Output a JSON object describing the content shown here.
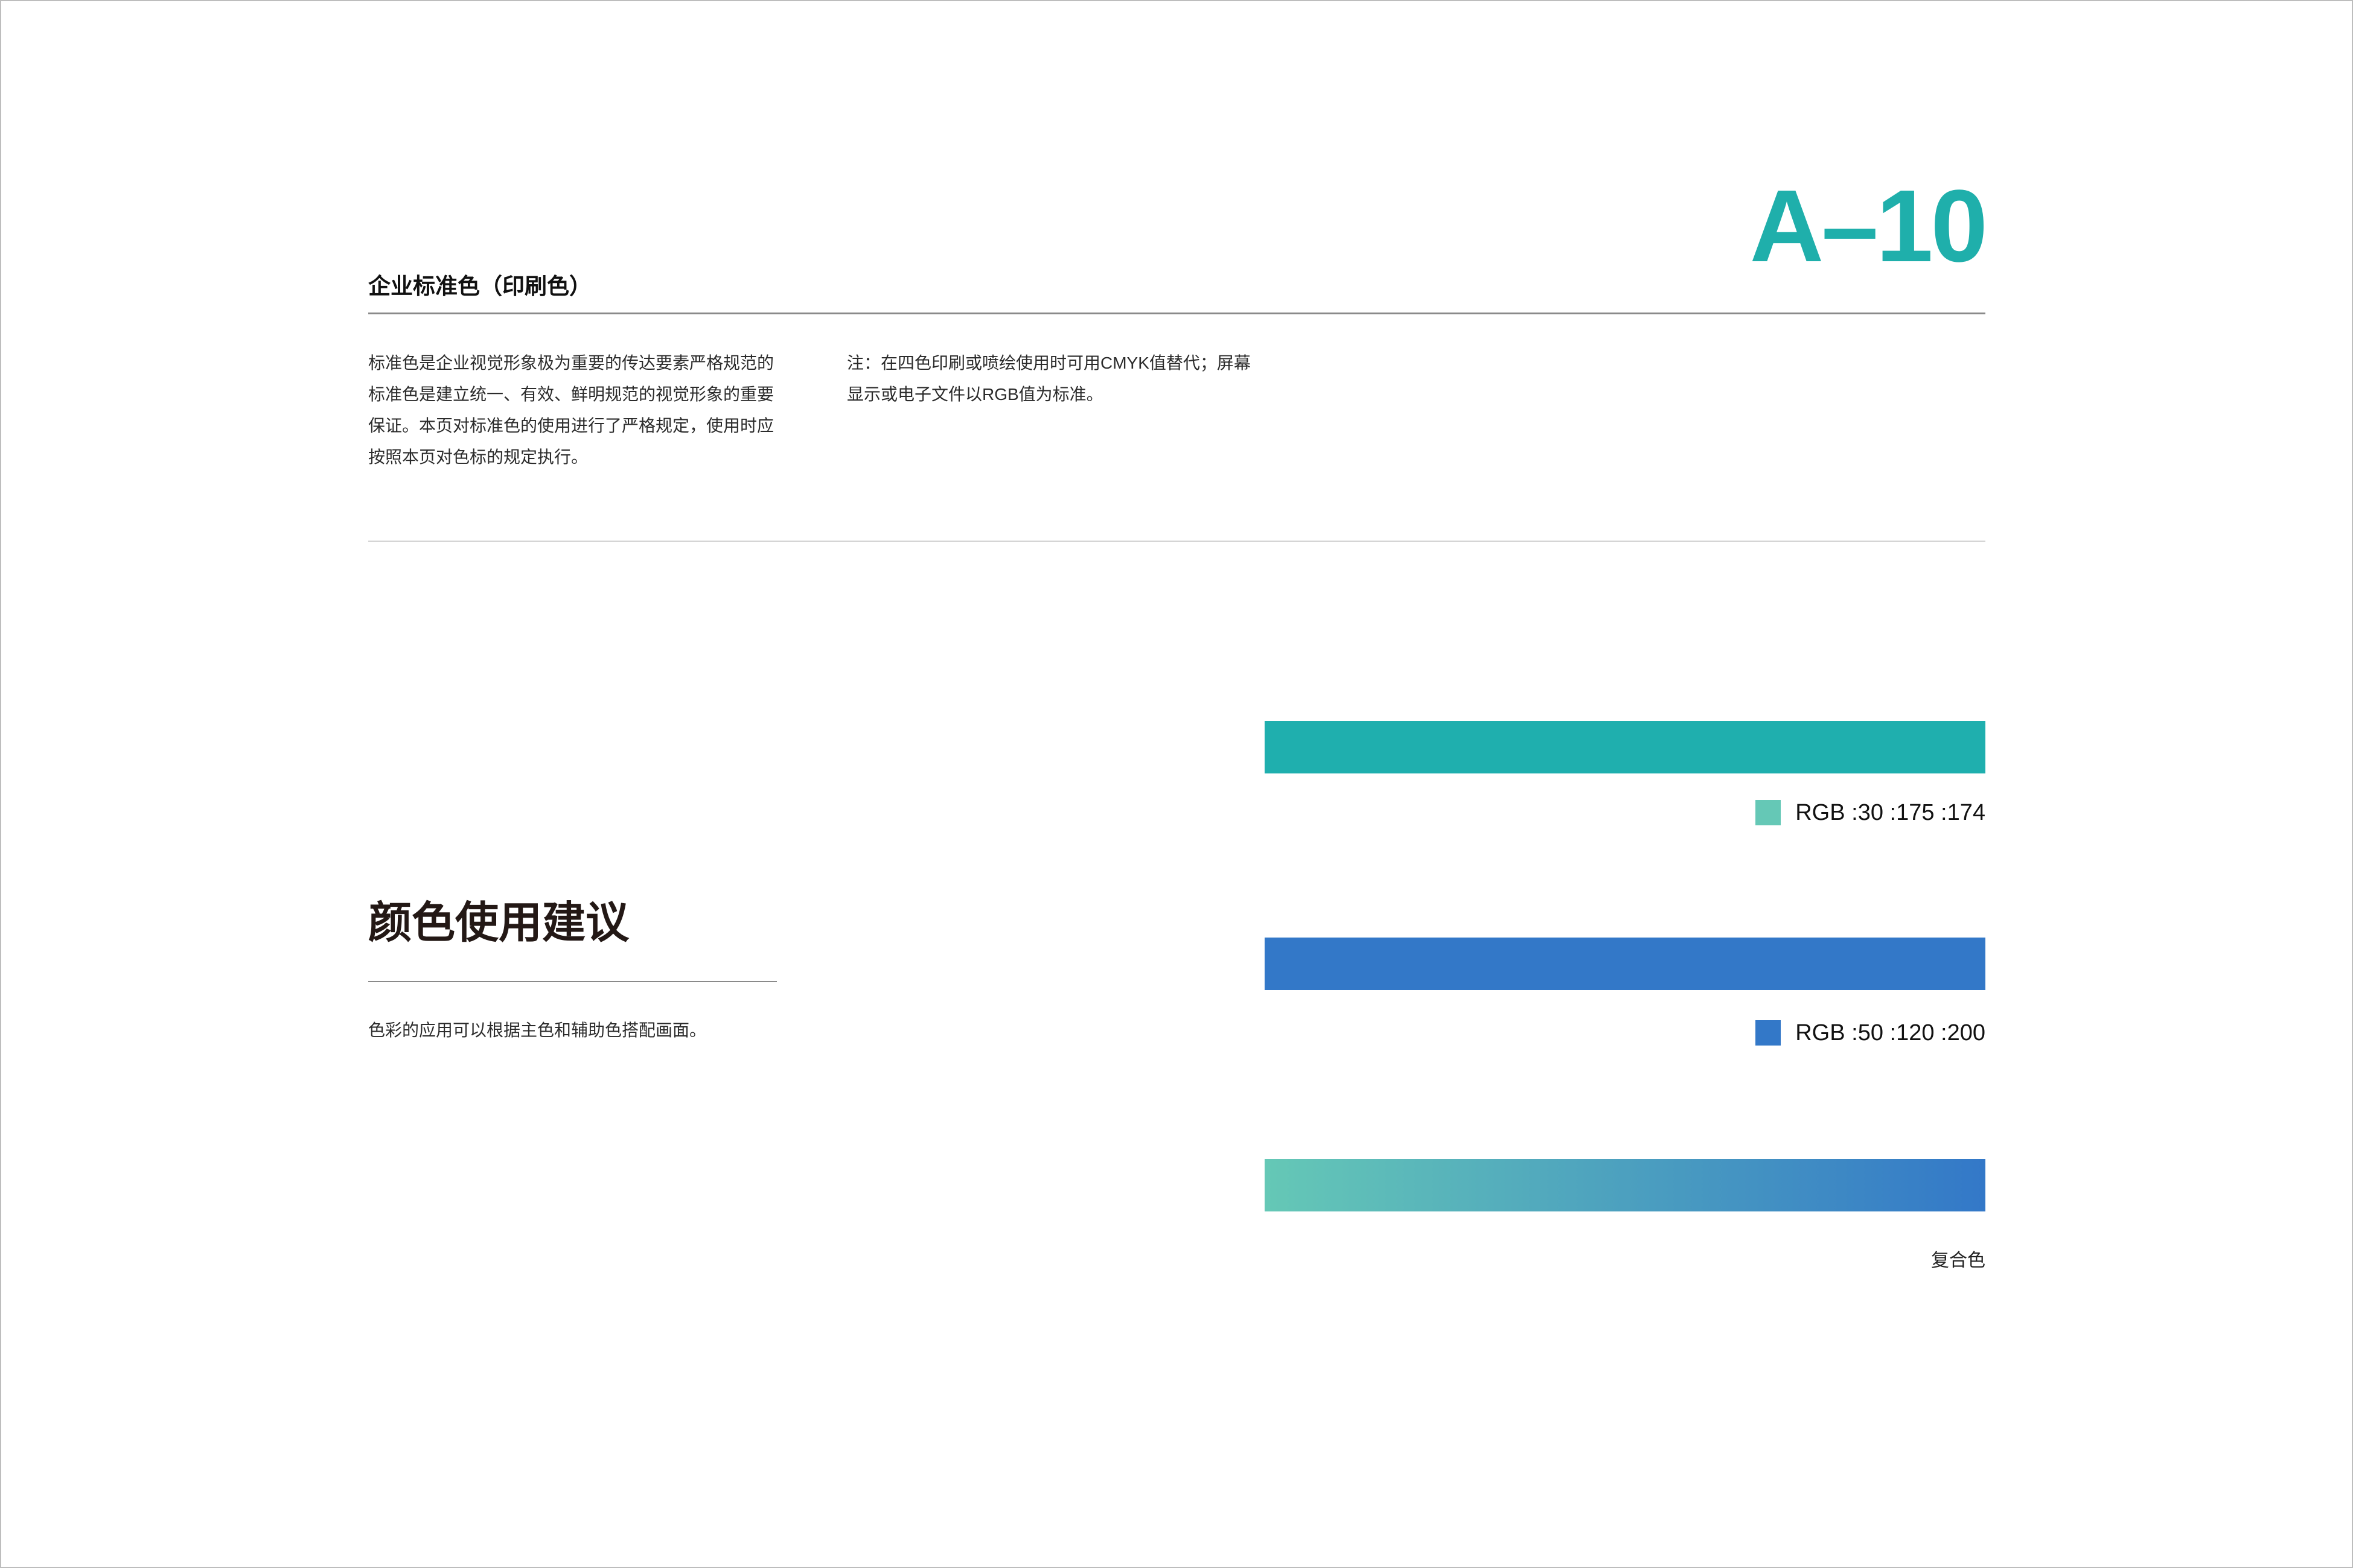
{
  "header": {
    "page_code": "A–10",
    "section_title": "企业标准色（印刷色）"
  },
  "intro": {
    "left_lines": [
      "标准色是企业视觉形象极为重要的传达要素严格规范的",
      "标准色是建立统一、有效、鲜明规范的视觉形象的重要",
      "保证。本页对标准色的使用进行了严格规定，使用时应",
      "按照本页对色标的规定执行。"
    ],
    "right_lines": [
      "注：在四色印刷或喷绘使用时可用CMYK值替代；屏幕",
      "显示或电子文件以RGB值为标准。"
    ]
  },
  "usage": {
    "title": "颜色使用建议",
    "note": "色彩的应用可以根据主色和辅助色搭配画面。"
  },
  "colors": {
    "primary_bar": "#1fafae",
    "primary_swatch": "#65c8b6",
    "primary_label": "RGB :30 :175 :174",
    "secondary_bar": "#3378c8",
    "secondary_swatch": "#3378c8",
    "secondary_label": "RGB :50 :120 :200",
    "gradient_start": "#65c8b6",
    "gradient_end": "#3378c8",
    "composite_label": "复合色"
  },
  "accent": "#1fafab"
}
